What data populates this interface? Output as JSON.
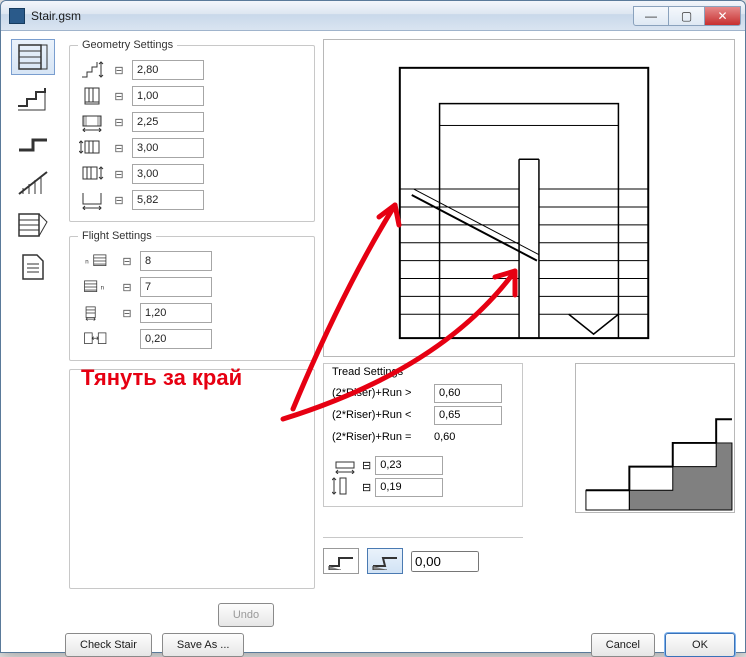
{
  "window": {
    "title": "Stair.gsm"
  },
  "geometry": {
    "legend": "Geometry Settings",
    "rows": [
      {
        "val": "2,80"
      },
      {
        "val": "1,00"
      },
      {
        "val": "2,25"
      },
      {
        "val": "3,00"
      },
      {
        "val": "3,00"
      },
      {
        "val": "5,82"
      }
    ]
  },
  "flight": {
    "legend": "Flight Settings",
    "rows": [
      {
        "val": "8"
      },
      {
        "val": "7"
      },
      {
        "val": "1,20"
      },
      {
        "val": "0,20"
      }
    ]
  },
  "tread": {
    "legend": "Tread Settings",
    "formula_gt_lbl": "(2*Riser)+Run >",
    "formula_gt_val": "0,60",
    "formula_lt_lbl": "(2*Riser)+Run <",
    "formula_lt_val": "0,65",
    "formula_eq_lbl": "(2*Riser)+Run =",
    "formula_eq_val": "0,60",
    "tread_depth": "0,23",
    "riser_height": "0,19",
    "nosing": "0,00"
  },
  "buttons": {
    "undo": "Undo",
    "check": "Check Stair",
    "saveas": "Save As ...",
    "cancel": "Cancel",
    "ok": "OK"
  },
  "annotation_text": "Тянуть за край"
}
